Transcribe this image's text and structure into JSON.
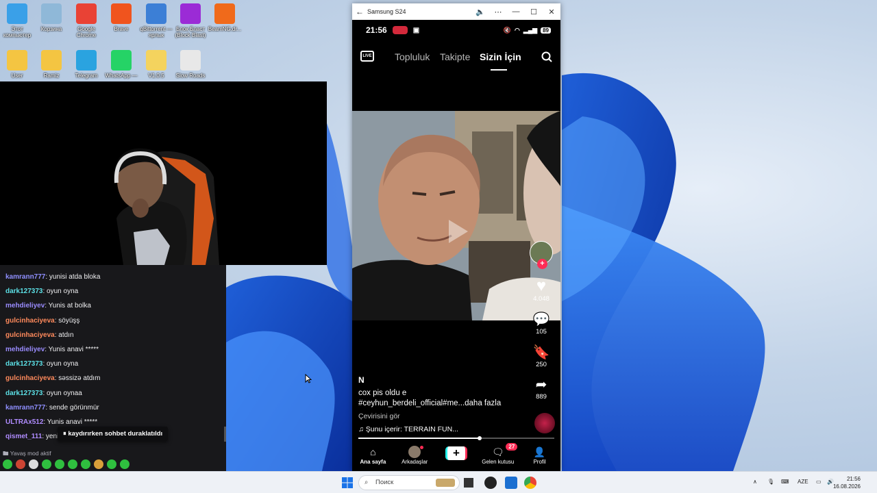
{
  "desktop": {
    "icons": [
      {
        "label": "Этот компьютер",
        "color": "#3aa0e8"
      },
      {
        "label": "Корзина",
        "color": "#8fb8d8"
      },
      {
        "label": "Google Chrome",
        "color": "#e94235"
      },
      {
        "label": "Brave",
        "color": "#f0541e"
      },
      {
        "label": "qBittorrent — ярлык",
        "color": "#3c7fd6"
      },
      {
        "label": "Блок Бласт (Block Blast)",
        "color": "#9b2bd6"
      },
      {
        "label": "BeamNG.dr...",
        "color": "#f06a1b"
      },
      {
        "label": "User",
        "color": "#f4c542"
      },
      {
        "label": "Ramiz",
        "color": "#f4c542"
      },
      {
        "label": "Telegram",
        "color": "#2aa3e0"
      },
      {
        "label": "WhatsApp — ...",
        "color": "#25d366"
      },
      {
        "label": "V1.0.5",
        "color": "#f4d35e"
      },
      {
        "label": "Slow Roads",
        "color": "#e8e8e8"
      }
    ]
  },
  "chat": {
    "messages": [
      {
        "user": "kamrann777",
        "text": ": yunisi atda bloka",
        "color": "#8f8fff"
      },
      {
        "user": "dark127373",
        "text": ": oyun oyna",
        "color": "#5ce0e6"
      },
      {
        "user": "mehdieliyev",
        "text": ": Yunis at bolka",
        "color": "#9a8cff"
      },
      {
        "user": "gulcinhaciyeva",
        "text": ": söyüşş",
        "color": "#ff8a5c"
      },
      {
        "user": "gulcinhaciyeva",
        "text": ": atdın",
        "color": "#ff8a5c"
      },
      {
        "user": "mehdieliyev",
        "text": ": Yunis anavi *****",
        "color": "#9a8cff"
      },
      {
        "user": "dark127373",
        "text": ": oyun oyna",
        "color": "#5ce0e6"
      },
      {
        "user": "gulcinhaciyeva",
        "text": ": səssizə atdım",
        "color": "#ff8a5c"
      },
      {
        "user": "dark127373",
        "text": ": oyun oynaa",
        "color": "#5ce0e6"
      },
      {
        "user": "kamrann777",
        "text": ": sende görünmür",
        "color": "#8f8fff"
      },
      {
        "user": "ULTRAx512",
        "text": ": Yunis anavi *****",
        "color": "#b08cff"
      },
      {
        "user": "qismet_111",
        "text": ": yeni",
        "color": "#b08cff"
      }
    ],
    "paused_label": "kaydırırken sohbet duraklatıldı",
    "slow_mode": "Yavaş mod aktif"
  },
  "phone": {
    "window_title": "Samsung S24",
    "time": "21:56",
    "battery": "89",
    "tabs": [
      "Topluluk",
      "Takipte",
      "Sizin İçin"
    ],
    "live_label": "LIVE",
    "actions": {
      "likes": "4.048",
      "comments": "105",
      "saves": "250",
      "shares": "889"
    },
    "caption": {
      "name": "N",
      "text": "cox pis oldu e",
      "tags": "#ceyhun_berdeli_official#me...",
      "more": "daha fazla",
      "translate": "Çevirisini gör",
      "music": "Şunu içerir: TERRAIN FUN..."
    },
    "progress": 0.62,
    "nav": [
      {
        "label": "Ana sayfa"
      },
      {
        "label": "Arkadaşlar"
      },
      {
        "label": ""
      },
      {
        "label": "Gelen kutusu",
        "badge": "27"
      },
      {
        "label": "Profil"
      }
    ]
  },
  "taskbar": {
    "search_placeholder": "Поиск",
    "lang": "AZE",
    "time": "21:56",
    "date": "16.08.2026"
  }
}
